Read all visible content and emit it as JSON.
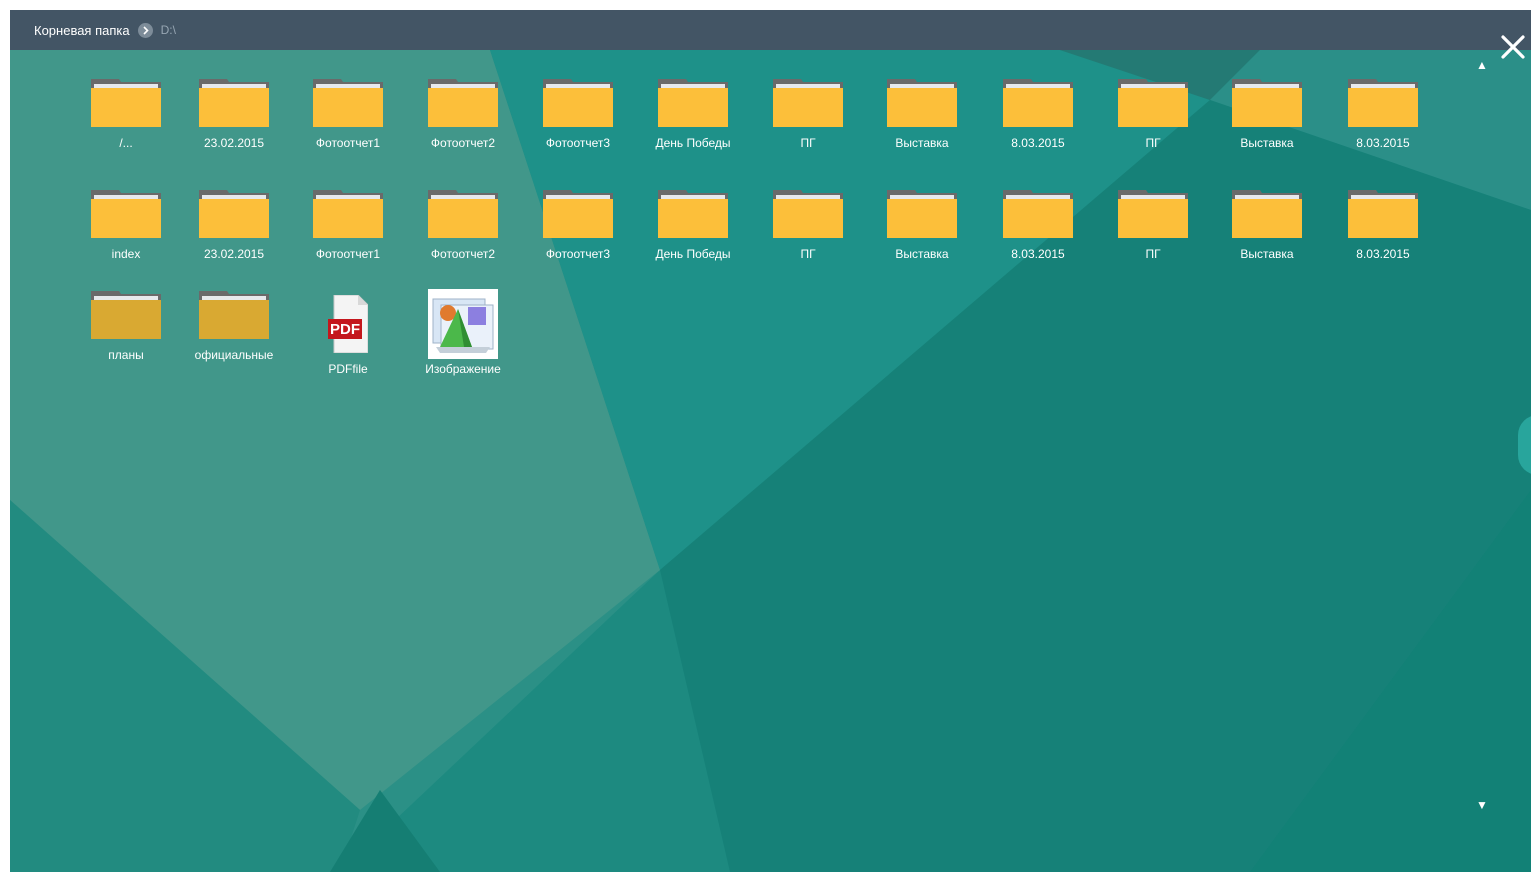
{
  "breadcrumb": {
    "root_label": "Корневая папка",
    "path": "D:\\"
  },
  "icons": {
    "close": "close-icon",
    "breadcrumb_separator": "chevron-right-icon",
    "scroll_up": "arrow-up-icon",
    "scroll_down": "arrow-down-icon",
    "folder": "folder-icon",
    "pdf": "pdf-file-icon",
    "image": "image-file-icon"
  },
  "colors": {
    "header_bg": "#435565",
    "background": "#1b8a80",
    "folder": "#fcbf3a",
    "folder_dim": "#d9a932"
  },
  "items": [
    {
      "label": "/...",
      "type": "folder"
    },
    {
      "label": "23.02.2015",
      "type": "folder"
    },
    {
      "label": "Фотоотчет1",
      "type": "folder"
    },
    {
      "label": "Фотоотчет2",
      "type": "folder"
    },
    {
      "label": "Фотоотчет3",
      "type": "folder"
    },
    {
      "label": "День Победы",
      "type": "folder"
    },
    {
      "label": "ПГ",
      "type": "folder"
    },
    {
      "label": "Выставка",
      "type": "folder"
    },
    {
      "label": "8.03.2015",
      "type": "folder"
    },
    {
      "label": "ПГ",
      "type": "folder"
    },
    {
      "label": "Выставка",
      "type": "folder"
    },
    {
      "label": "8.03.2015",
      "type": "folder"
    },
    {
      "label": "index",
      "type": "folder"
    },
    {
      "label": "23.02.2015",
      "type": "folder"
    },
    {
      "label": "Фотоотчет1",
      "type": "folder"
    },
    {
      "label": "Фотоотчет2",
      "type": "folder"
    },
    {
      "label": "Фотоотчет3",
      "type": "folder"
    },
    {
      "label": "День Победы",
      "type": "folder"
    },
    {
      "label": "ПГ",
      "type": "folder"
    },
    {
      "label": "Выставка",
      "type": "folder"
    },
    {
      "label": "8.03.2015",
      "type": "folder"
    },
    {
      "label": "ПГ",
      "type": "folder"
    },
    {
      "label": "Выставка",
      "type": "folder"
    },
    {
      "label": "8.03.2015",
      "type": "folder"
    },
    {
      "label": "планы",
      "type": "folder",
      "dim": true
    },
    {
      "label": "официальные",
      "type": "folder",
      "dim": true
    },
    {
      "label": "PDFfile",
      "type": "pdf",
      "badge": "PDF"
    },
    {
      "label": "Изображение",
      "type": "image"
    }
  ]
}
